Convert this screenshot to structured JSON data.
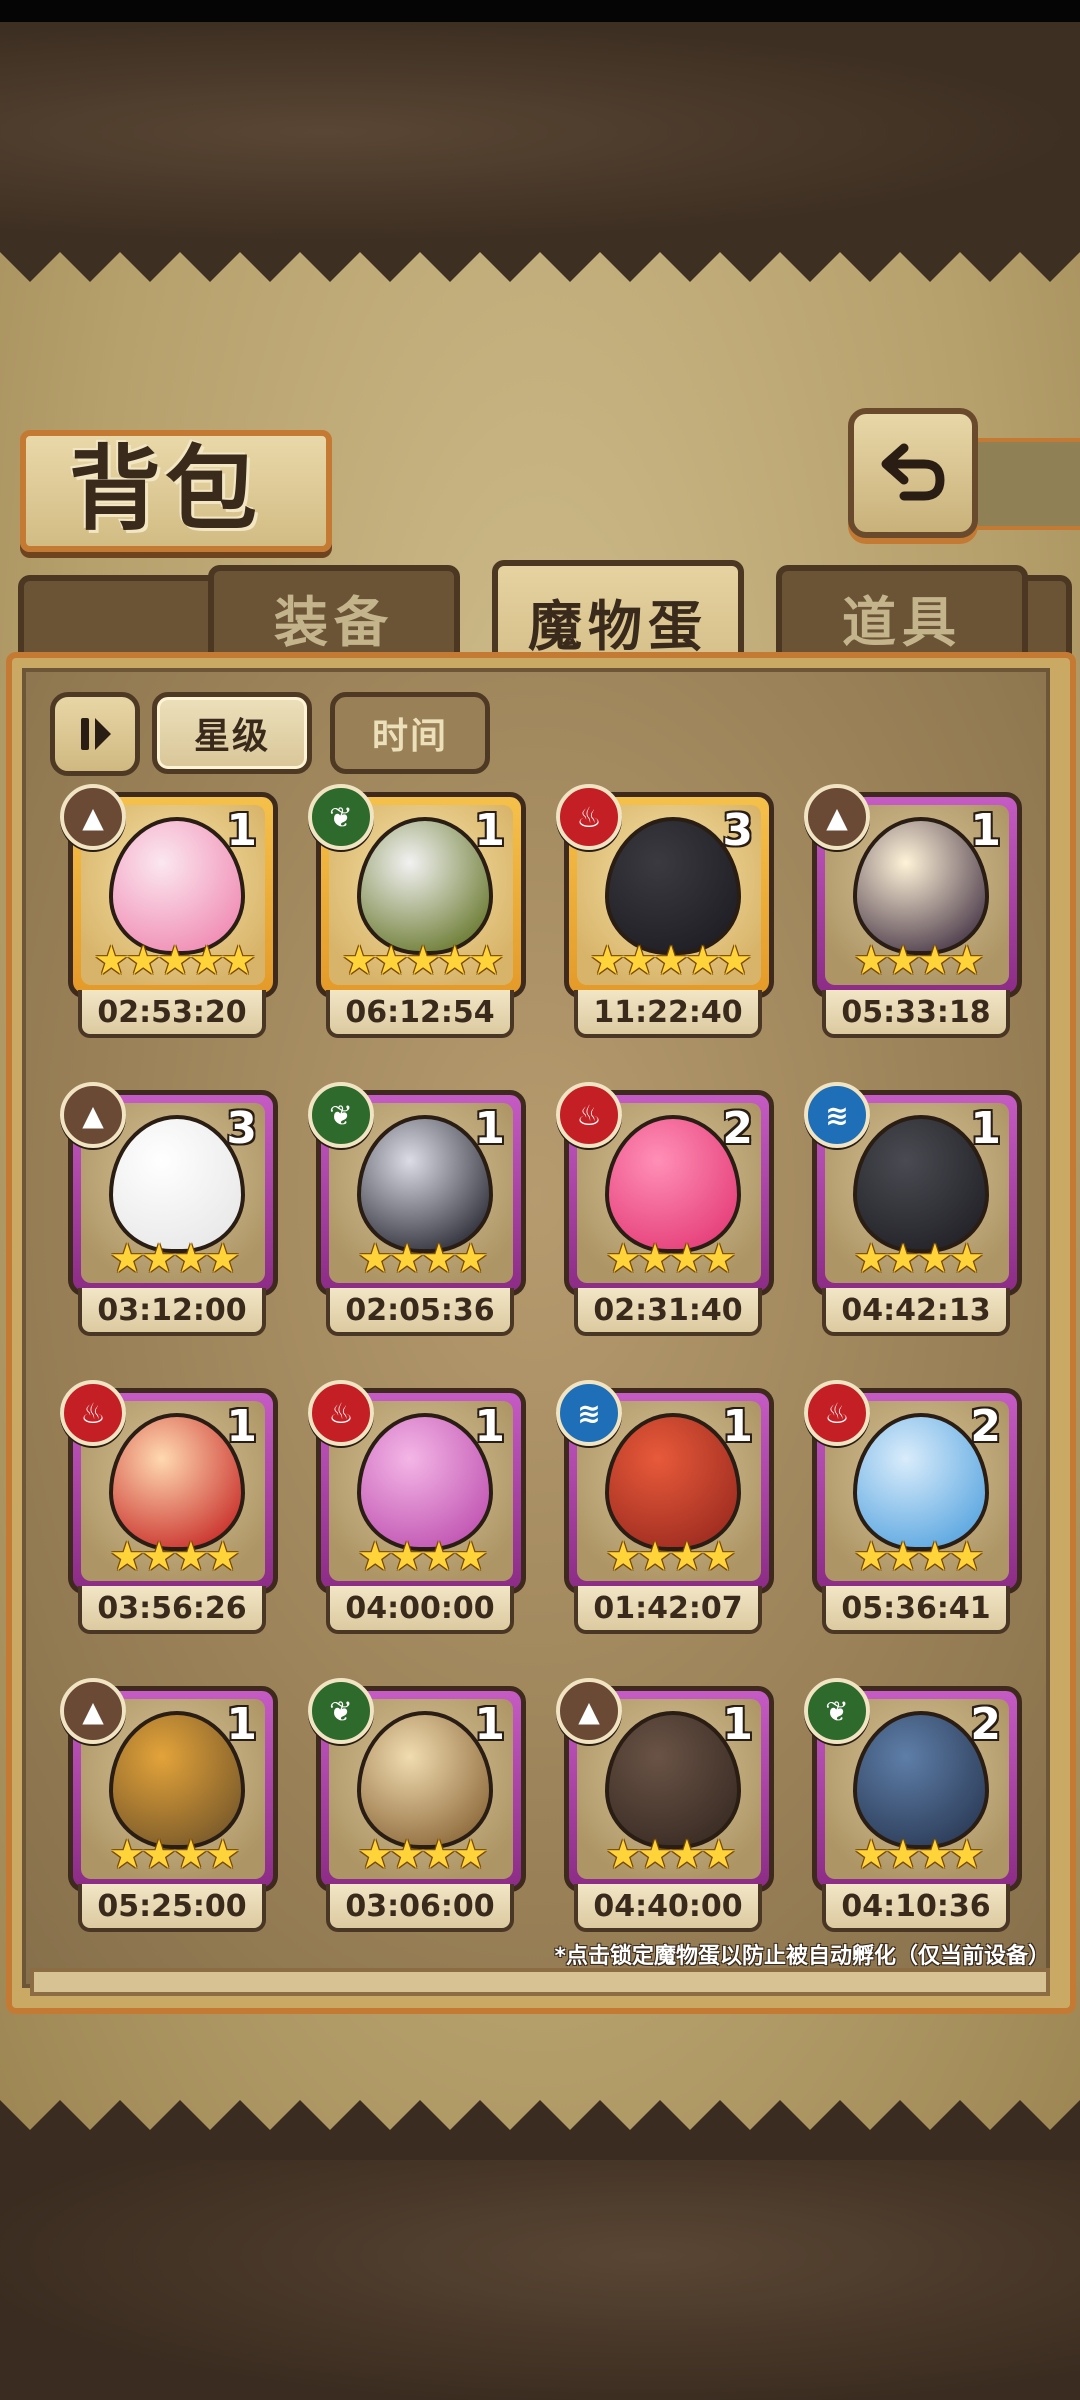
{
  "header": {
    "title": "背包",
    "back_icon": "return-arrow-icon"
  },
  "tabs": [
    {
      "label": "装备",
      "active": false
    },
    {
      "label": "魔物蛋",
      "active": true
    },
    {
      "label": "道具",
      "active": false
    }
  ],
  "filters": {
    "sort_icon": "sort-toggle-icon",
    "star_label": "星级",
    "time_label": "时间",
    "active": "星级"
  },
  "eggs": [
    {
      "element": "earth",
      "count": "1",
      "stars": 5,
      "timer": "02:53:20",
      "rarity": "gold"
    },
    {
      "element": "leaf",
      "count": "1",
      "stars": 5,
      "timer": "06:12:54",
      "rarity": "gold"
    },
    {
      "element": "fire",
      "count": "3",
      "stars": 5,
      "timer": "11:22:40",
      "rarity": "gold"
    },
    {
      "element": "earth",
      "count": "1",
      "stars": 4,
      "timer": "05:33:18",
      "rarity": "purple"
    },
    {
      "element": "earth",
      "count": "3",
      "stars": 4,
      "timer": "03:12:00",
      "rarity": "purple"
    },
    {
      "element": "leaf",
      "count": "1",
      "stars": 4,
      "timer": "02:05:36",
      "rarity": "purple"
    },
    {
      "element": "fire",
      "count": "2",
      "stars": 4,
      "timer": "02:31:40",
      "rarity": "purple"
    },
    {
      "element": "water",
      "count": "1",
      "stars": 4,
      "timer": "04:42:13",
      "rarity": "purple"
    },
    {
      "element": "fire",
      "count": "1",
      "stars": 4,
      "timer": "03:56:26",
      "rarity": "purple"
    },
    {
      "element": "fire",
      "count": "1",
      "stars": 4,
      "timer": "04:00:00",
      "rarity": "purple"
    },
    {
      "element": "water",
      "count": "1",
      "stars": 4,
      "timer": "01:42:07",
      "rarity": "purple"
    },
    {
      "element": "fire",
      "count": "2",
      "stars": 4,
      "timer": "05:36:41",
      "rarity": "purple"
    },
    {
      "element": "earth",
      "count": "1",
      "stars": 4,
      "timer": "05:25:00",
      "rarity": "purple"
    },
    {
      "element": "leaf",
      "count": "1",
      "stars": 4,
      "timer": "03:06:00",
      "rarity": "purple"
    },
    {
      "element": "earth",
      "count": "1",
      "stars": 4,
      "timer": "04:40:00",
      "rarity": "purple"
    },
    {
      "element": "leaf",
      "count": "2",
      "stars": 4,
      "timer": "04:10:36",
      "rarity": "purple"
    }
  ],
  "hint": "*点击锁定魔物蛋以防止被自动孵化（仅当前设备）",
  "colors": {
    "gold_card": "#f0b23a",
    "purple_card": "#b04aae",
    "fire": "#c41f24",
    "leaf": "#2e6a2c",
    "water": "#1f6fb8",
    "earth": "#6b4a35"
  }
}
